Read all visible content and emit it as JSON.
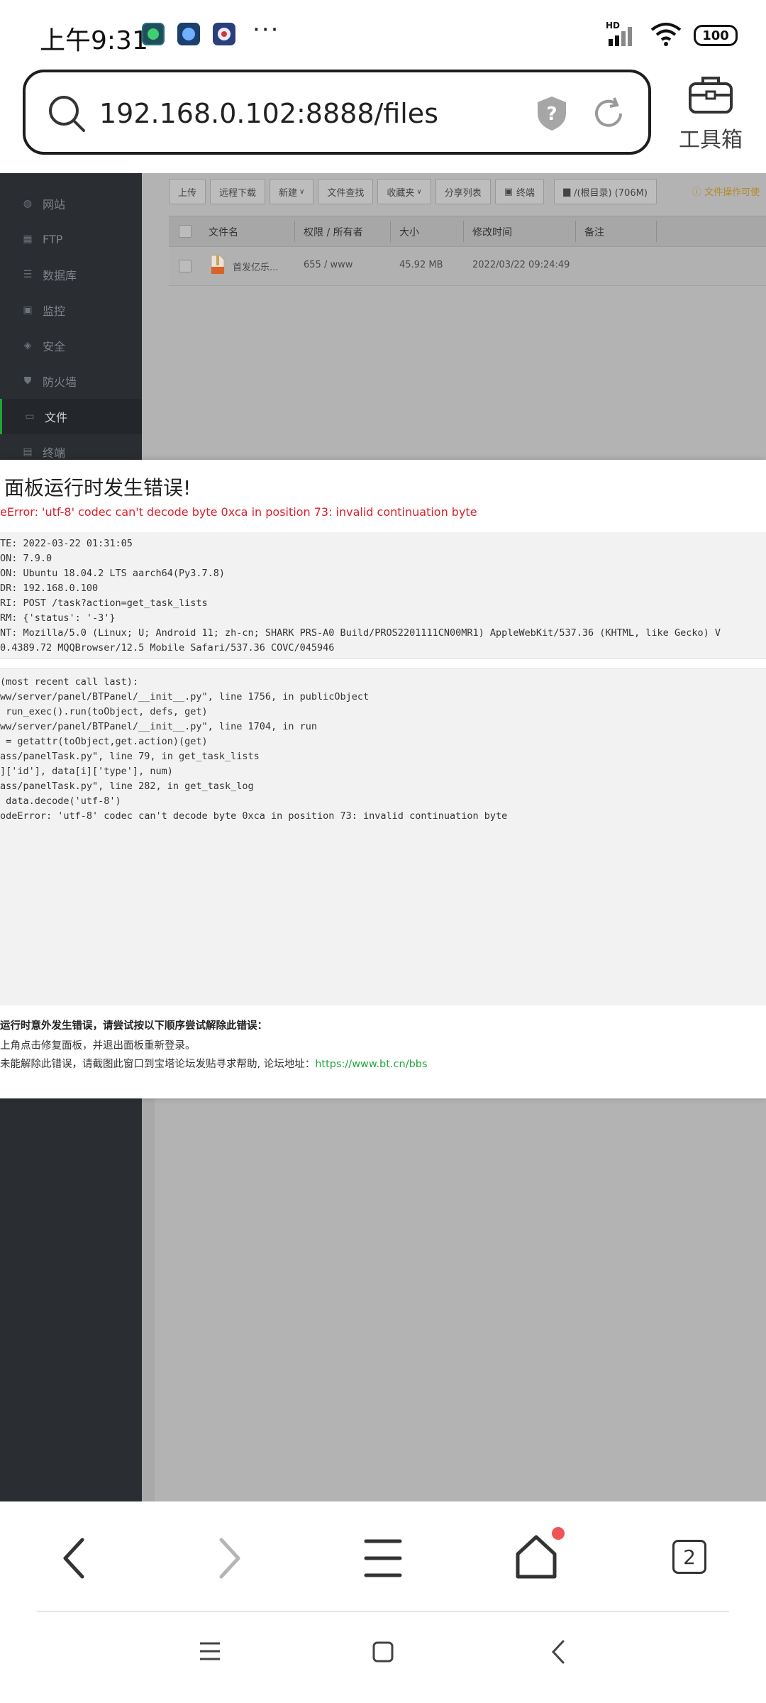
{
  "status_bar": {
    "time": "上午9:31",
    "more": "···",
    "signal_label": "HD",
    "battery": "100"
  },
  "browser": {
    "url": "192.168.0.102:8888/files",
    "toolbox_label": "工具箱",
    "tab_count": "2"
  },
  "sidebar": {
    "items": [
      {
        "label": "网站",
        "icon": "globe-icon"
      },
      {
        "label": "FTP",
        "icon": "ftp-icon"
      },
      {
        "label": "数据库",
        "icon": "database-icon"
      },
      {
        "label": "监控",
        "icon": "monitor-icon"
      },
      {
        "label": "安全",
        "icon": "shield-icon"
      },
      {
        "label": "防火墙",
        "icon": "firewall-icon"
      },
      {
        "label": "文件",
        "icon": "folder-icon"
      },
      {
        "label": "终端",
        "icon": "terminal-icon"
      }
    ],
    "active": "文件"
  },
  "toolbar": {
    "buttons": [
      "上传",
      "远程下载",
      "新建",
      "文件查找",
      "收藏夹",
      "分享列表",
      "终端",
      "/(根目录) (706M)"
    ],
    "tip": "文件操作可使"
  },
  "file_table": {
    "headers": [
      "文件名",
      "权限 / 所有者",
      "大小",
      "修改时间",
      "备注"
    ],
    "rows": [
      {
        "name": "首发亿乐...",
        "perm": "655 / www",
        "size": "45.92 MB",
        "mtime": "2022/03/22 09:24:49",
        "note": ""
      }
    ]
  },
  "error": {
    "title": "面板运行时发生错误!",
    "message": "eError: 'utf-8' codec can't decode byte 0xca in position 73: invalid continuation byte",
    "info_lines": [
      "TE: 2022-03-22 01:31:05",
      "ON: 7.9.0",
      "ON: Ubuntu 18.04.2 LTS aarch64(Py3.7.8)",
      "DR: 192.168.0.100",
      "RI: POST /task?action=get_task_lists",
      "RM: {'status': '-3'}",
      "NT: Mozilla/5.0 (Linux; U; Android 11; zh-cn; SHARK PRS-A0 Build/PROS2201111CN00MR1) AppleWebKit/537.36 (KHTML, like Gecko) V",
      "0.4389.72 MQQBrowser/12.5 Mobile Safari/537.36 COVC/045946"
    ],
    "trace_lines": [
      "(most recent call last):",
      "ww/server/panel/BTPanel/__init__.py\", line 1756, in publicObject",
      " run_exec().run(toObject, defs, get)",
      "ww/server/panel/BTPanel/__init__.py\", line 1704, in run",
      " = getattr(toObject,get.action)(get)",
      "ass/panelTask.py\", line 79, in get_task_lists",
      "]['id'], data[i]['type'], num)",
      "ass/panelTask.py\", line 282, in get_task_log",
      " data.decode('utf-8')",
      "odeError: 'utf-8' codec can't decode byte 0xca in position 73: invalid continuation byte"
    ],
    "help_title": "运行时意外发生错误，请尝试按以下顺序尝试解除此错误：",
    "help_line1": "上角点击修复面板，并退出面板重新登录。",
    "help_line2_prefix": "未能解除此错误，请截图此窗口到宝塔论坛发贴寻求帮助, 论坛地址：",
    "help_link": "https://www.bt.cn/bbs"
  }
}
